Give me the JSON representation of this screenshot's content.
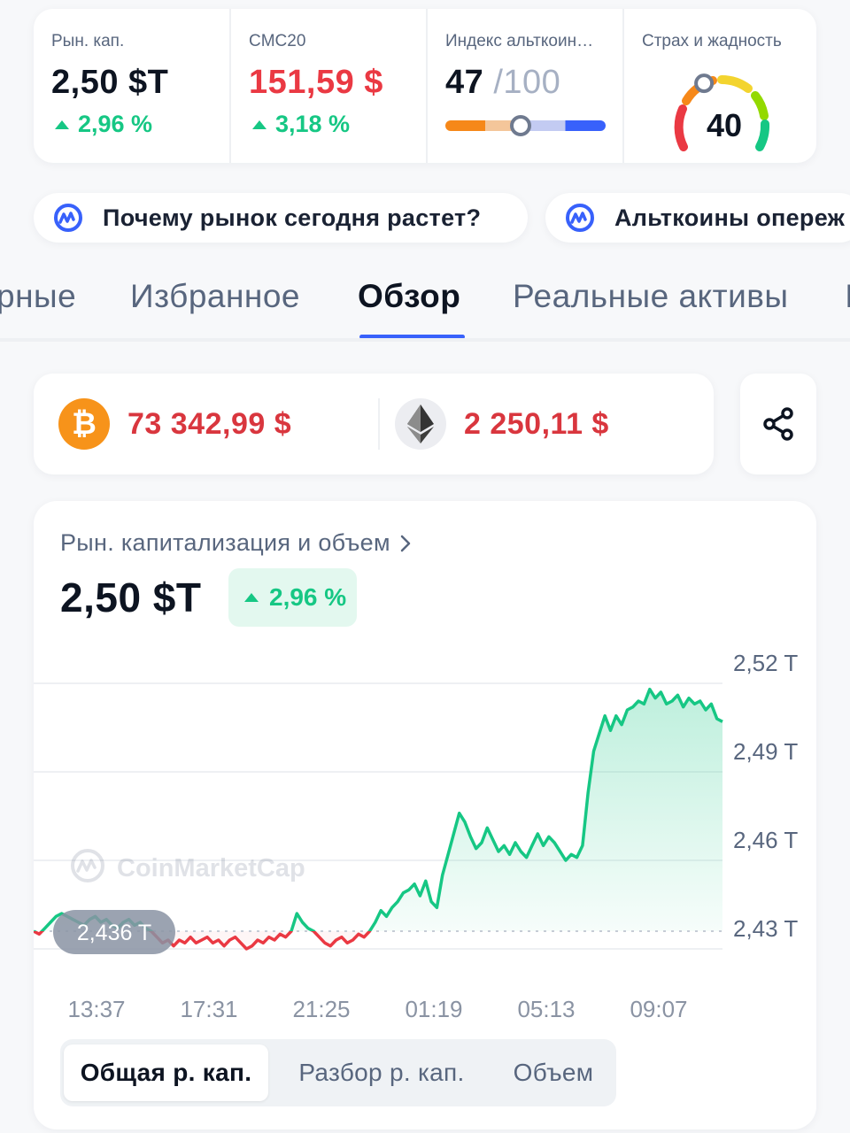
{
  "stats": [
    {
      "label": "Рын. кап.",
      "value": "2,50 $T",
      "change": "2,96 %"
    },
    {
      "label": "CMC20",
      "value": "151,59 $",
      "change": "3,18 %"
    },
    {
      "label": "Индекс альткоин…",
      "value": "47",
      "value_suffix": "/100",
      "level": 0.47
    },
    {
      "label": "Страх и жадность",
      "value": "40",
      "level": 0.4
    }
  ],
  "chips": [
    {
      "icon": "cmc-ai-icon",
      "text": "Почему рынок сегодня растет?"
    },
    {
      "icon": "cmc-ai-icon",
      "text": "Альткоины опереж"
    }
  ],
  "tabs": [
    {
      "label": "рные",
      "active": false
    },
    {
      "label": "Избранное",
      "active": false
    },
    {
      "label": "Обзор",
      "active": true
    },
    {
      "label": "Реальные активы",
      "active": false
    },
    {
      "label": "I",
      "active": false
    }
  ],
  "prices": {
    "btc": {
      "symbol": "₿",
      "price": "73 342,99 $"
    },
    "eth": {
      "price": "2 250,11 $"
    }
  },
  "card": {
    "title": "Рын. капитализация и объем",
    "value": "2,50 $T",
    "change": "2,96 %",
    "watermark": "CoinMarketCap",
    "baseline_label": "2,436 T",
    "segments": [
      {
        "label": "Общая р. кап.",
        "active": true
      },
      {
        "label": "Разбор р. кап.",
        "active": false
      },
      {
        "label": "Объем",
        "active": false
      }
    ]
  },
  "colors": {
    "up": "#16c784",
    "down": "#ea3943",
    "accent": "#3861fb"
  },
  "chart_data": {
    "type": "line",
    "title": "",
    "baseline": 2.436,
    "ylim": [
      2.42,
      2.527
    ],
    "y_ticks": [
      2.43,
      2.46,
      2.49,
      2.52
    ],
    "y_tick_labels": [
      "2,43 T",
      "2,46 T",
      "2,49 T",
      "2,52 T"
    ],
    "x_tick_labels": [
      "13:37",
      "17:31",
      "21:25",
      "01:19",
      "05:13",
      "09:07"
    ],
    "series": [
      {
        "values": [
          2.436,
          2.435,
          2.437,
          2.439,
          2.441,
          2.442,
          2.441,
          2.44,
          2.439,
          2.438,
          2.44,
          2.441,
          2.439,
          2.44,
          2.438,
          2.437,
          2.439,
          2.44,
          2.438,
          2.439,
          2.437,
          2.436,
          2.434,
          2.432,
          2.433,
          2.431,
          2.433,
          2.432,
          2.434,
          2.432,
          2.433,
          2.434,
          2.432,
          2.433,
          2.431,
          2.433,
          2.434,
          2.432,
          2.43,
          2.431,
          2.433,
          2.432,
          2.434,
          2.433,
          2.435,
          2.434,
          2.436,
          2.442,
          2.439,
          2.437,
          2.436,
          2.434,
          2.432,
          2.431,
          2.433,
          2.434,
          2.432,
          2.433,
          2.435,
          2.434,
          2.436,
          2.439,
          2.443,
          2.441,
          2.444,
          2.446,
          2.449,
          2.45,
          2.452,
          2.448,
          2.453,
          2.446,
          2.444,
          2.455,
          2.462,
          2.469,
          2.476,
          2.473,
          2.468,
          2.464,
          2.466,
          2.471,
          2.467,
          2.463,
          2.465,
          2.462,
          2.466,
          2.463,
          2.461,
          2.465,
          2.469,
          2.465,
          2.468,
          2.466,
          2.463,
          2.46,
          2.462,
          2.461,
          2.465,
          2.483,
          2.497,
          2.503,
          2.509,
          2.504,
          2.509,
          2.506,
          2.511,
          2.512,
          2.514,
          2.513,
          2.518,
          2.515,
          2.517,
          2.513,
          2.514,
          2.516,
          2.512,
          2.515,
          2.513,
          2.514,
          2.511,
          2.513,
          2.508,
          2.507
        ]
      }
    ]
  }
}
